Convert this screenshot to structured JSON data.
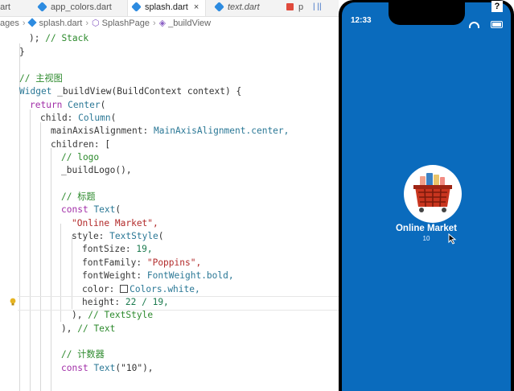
{
  "tabs": [
    {
      "label": "dart",
      "icon": "dart-file-icon"
    },
    {
      "label": "app_colors.dart",
      "icon": "dart-file-icon"
    },
    {
      "label": "splash.dart",
      "icon": "dart-file-icon",
      "active": true,
      "close": "×"
    },
    {
      "label": "text.dart",
      "icon": "dart-file-icon",
      "italic": true
    },
    {
      "label": "p",
      "icon": "pdf-file-icon"
    }
  ],
  "debug_toolbar": {
    "label": "| ||"
  },
  "breadcrumb": {
    "folder": "ages",
    "file": "splash.dart",
    "class": "SplashPage",
    "method": "_buildView",
    "method_icon": "cube-icon"
  },
  "code": {
    "line1": ");",
    "line1_comment": "// Stack",
    "line2": "}",
    "comment_main": "// 主视图",
    "sig_widget": "Widget",
    "sig_name": "_buildView",
    "sig_params": "(BuildContext context) {",
    "ret_kw": "return",
    "ret_type": "Center",
    "ret_paren": "(",
    "child_prop": "child:",
    "child_type": "Column",
    "child_paren": "(",
    "align_prop": "mainAxisAlignment:",
    "align_val": "MainAxisAlignment.center,",
    "children_prop": "children:",
    "children_br": "[",
    "comment_logo": "// logo",
    "build_logo": "_buildLogo(),",
    "comment_title": "// 标题",
    "const1": "const",
    "text_type": "Text",
    "text_paren": "(",
    "str_online": "\"Online Market\",",
    "style_prop": "style:",
    "style_type": "TextStyle",
    "style_paren": "(",
    "fs_prop": "fontSize:",
    "fs_val": "19,",
    "ff_prop": "fontFamily:",
    "ff_val": "\"Poppins\",",
    "fw_prop": "fontWeight:",
    "fw_val": "FontWeight.bold,",
    "color_prop": "color:",
    "color_val": "Colors.white,",
    "height_prop": "height:",
    "height_val": "22 / 19,",
    "close_style": "),",
    "close_style_comment": "// TextStyle",
    "close_text": "),",
    "close_text_comment": "// Text",
    "comment_counter": "// 计数器",
    "const2": "const",
    "text2": "Text",
    "text2_arg": "(\"10\"),"
  },
  "simulator": {
    "time": "12:33",
    "title": "Online Market",
    "counter": "10",
    "help": "?",
    "colors": {
      "background": "#0a6bbd",
      "text": "#ffffff"
    }
  }
}
